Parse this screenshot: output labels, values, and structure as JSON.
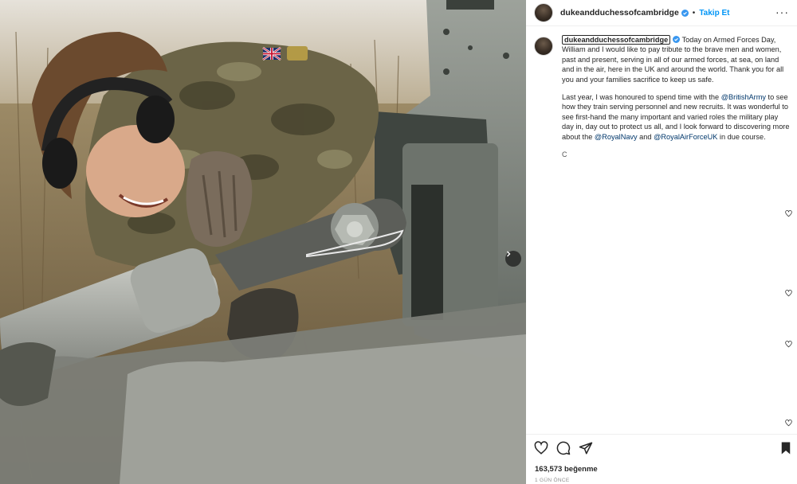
{
  "header": {
    "username": "dukeandduchessofcambridge",
    "separator": "•",
    "follow_label": "Takip Et",
    "more_label": "···"
  },
  "caption": {
    "username": "dukeandduchessofcambridge",
    "paragraph1": "Today on Armed Forces Day, William and I would like to pay tribute to the brave men and women, past and present, serving in all of our armed forces, at sea, on land and in the air, here in the UK and around the world. Thank you for all you and your families sacrifice to keep us safe.",
    "p2_part1": "Last year, I was honoured to spend time with the ",
    "p2_mention1": "@BritishArmy",
    "p2_part2": " to see how they train serving personnel and new recruits. It was wonderful to see first-hand the many important and varied roles the military play day in, day out to protect us all, and I look forward to discovering more about the ",
    "p2_mention2": "@RoyalNavy",
    "p2_part3": " and ",
    "p2_mention3": "@RoyalAirForceUK",
    "p2_part4": " in due course.",
    "trailing": "C"
  },
  "icons": {
    "verified": "verified-badge-icon",
    "like": "heart-icon",
    "comment": "comment-icon",
    "share": "paper-plane-icon",
    "save": "bookmark-icon",
    "next": "chevron-right-icon"
  },
  "footer": {
    "likes": "163,573 beğenme",
    "time": "1 GÜN ÖNCE"
  },
  "colors": {
    "link": "#00376b",
    "follow": "#0095f6",
    "verified": "#3897f0"
  }
}
